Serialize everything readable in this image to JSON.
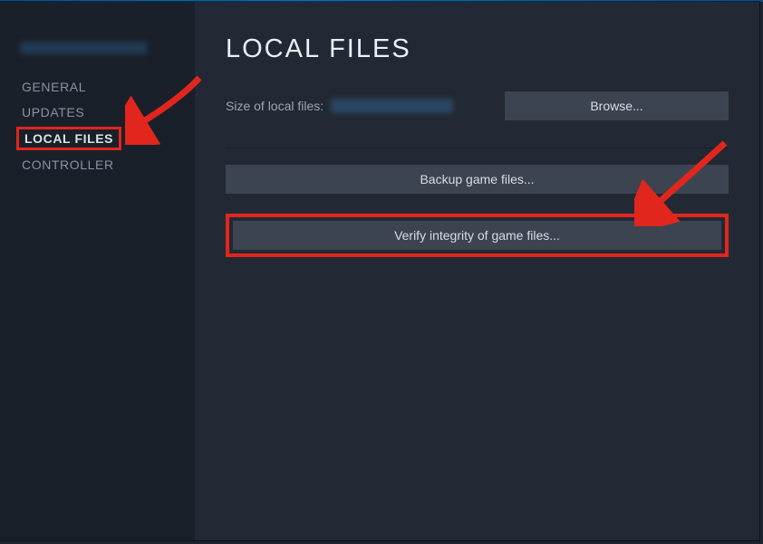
{
  "sidebar": {
    "items": [
      {
        "label": "GENERAL"
      },
      {
        "label": "UPDATES"
      },
      {
        "label": "LOCAL FILES"
      },
      {
        "label": "CONTROLLER"
      }
    ]
  },
  "main": {
    "title": "LOCAL FILES",
    "size_label": "Size of local files:",
    "browse_label": "Browse...",
    "backup_label": "Backup game files...",
    "verify_label": "Verify integrity of game files..."
  },
  "close_glyph": "×",
  "colors": {
    "highlight": "#e1261d",
    "button_bg": "#3d4451",
    "page_bg": "#222934",
    "sidebar_bg": "#1a2029"
  }
}
